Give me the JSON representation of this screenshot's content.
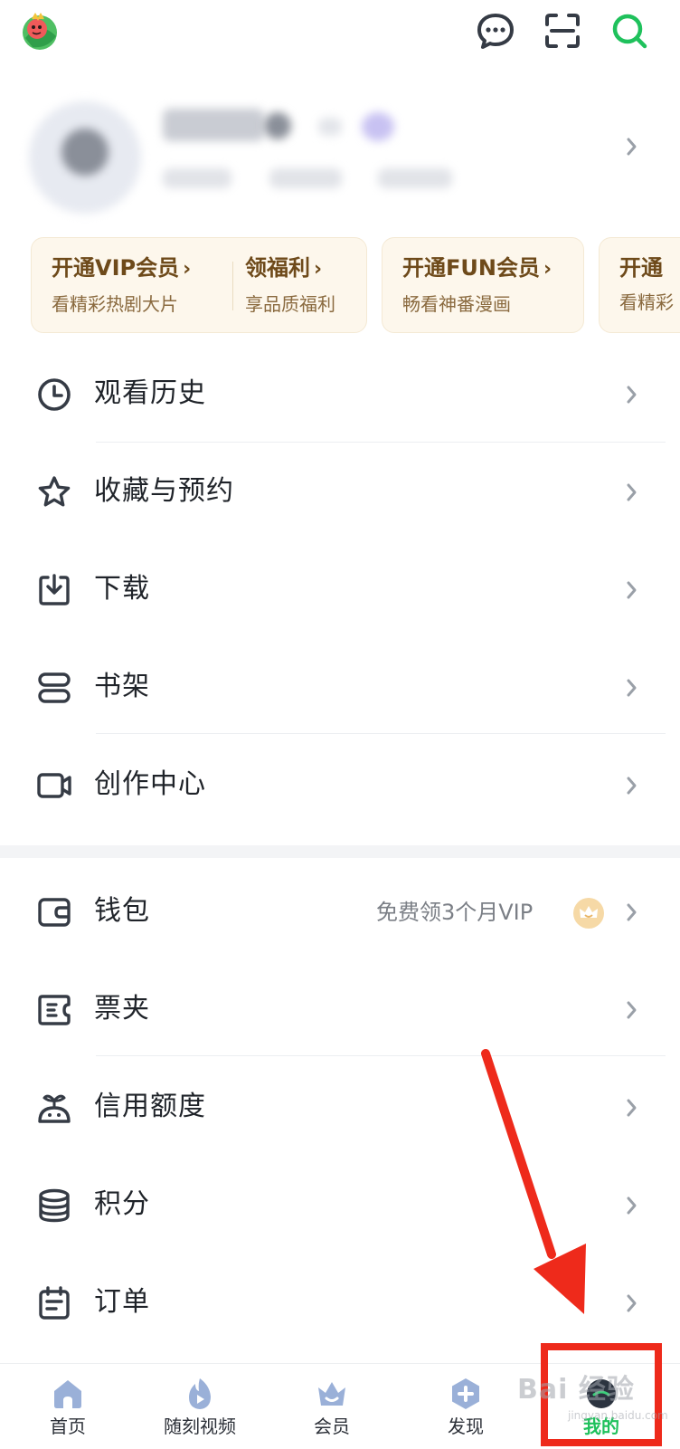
{
  "vip_cards": [
    {
      "title": "开通VIP会员",
      "subtitle": "看精彩热剧大片"
    },
    {
      "title": "领福利",
      "subtitle": "享品质福利"
    },
    {
      "title": "开通FUN会员",
      "subtitle": "畅看神番漫画"
    },
    {
      "title": "开通",
      "subtitle": "看精彩"
    }
  ],
  "menu": {
    "history": "观看历史",
    "favorites": "收藏与预约",
    "download": "下载",
    "bookshelf": "书架",
    "creator": "创作中心",
    "wallet": "钱包",
    "wallet_promo": "免费领3个月VIP",
    "tickets": "票夹",
    "credit": "信用额度",
    "points": "积分",
    "orders": "订单"
  },
  "bottom_nav": {
    "home": "首页",
    "shorts": "随刻视频",
    "vip": "会员",
    "discover": "发现",
    "mine": "我的"
  },
  "watermark": {
    "main": "Bai 经验",
    "sub": "jingyan.baidu.com"
  },
  "colors": {
    "accent_green": "#1fc15c",
    "annotation_red": "#ee2a1b",
    "vip_gold": "#6e4a1a",
    "icon_dark": "#353b45"
  },
  "icons": [
    "app-logo",
    "message-icon",
    "scan-icon",
    "search-icon",
    "clock-icon",
    "star-icon",
    "download-icon",
    "bookshelf-icon",
    "video-camera-icon",
    "wallet-icon",
    "ticket-icon",
    "credit-icon",
    "coins-icon",
    "order-icon",
    "crown-icon",
    "home-icon",
    "flame-icon",
    "crown-nav-icon",
    "plus-icon",
    "avatar-nav-icon"
  ]
}
